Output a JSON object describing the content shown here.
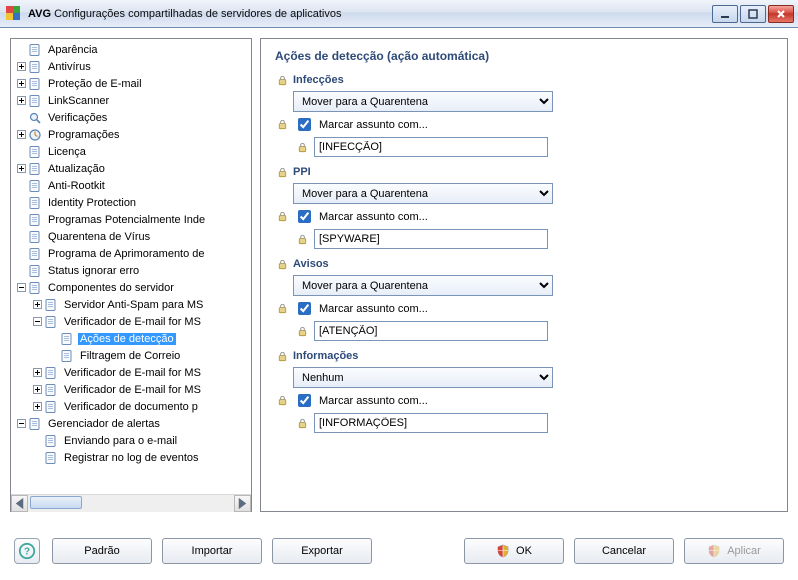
{
  "window": {
    "title_app": "AVG",
    "title_rest": "Configurações compartilhadas de servidores de aplicativos"
  },
  "tree": {
    "items": [
      {
        "level": 1,
        "exp": "",
        "icon": "page",
        "label": "Aparência"
      },
      {
        "level": 1,
        "exp": "plus",
        "icon": "page",
        "label": "Antivírus"
      },
      {
        "level": 1,
        "exp": "plus",
        "icon": "page",
        "label": "Proteção de E-mail"
      },
      {
        "level": 1,
        "exp": "plus",
        "icon": "page",
        "label": "LinkScanner"
      },
      {
        "level": 1,
        "exp": "",
        "icon": "magnify",
        "label": "Verificações"
      },
      {
        "level": 1,
        "exp": "plus",
        "icon": "clock",
        "label": "Programações"
      },
      {
        "level": 1,
        "exp": "",
        "icon": "page",
        "label": "Licença"
      },
      {
        "level": 1,
        "exp": "plus",
        "icon": "page",
        "label": "Atualização"
      },
      {
        "level": 1,
        "exp": "",
        "icon": "page",
        "label": "Anti-Rootkit"
      },
      {
        "level": 1,
        "exp": "",
        "icon": "page",
        "label": "Identity Protection"
      },
      {
        "level": 1,
        "exp": "",
        "icon": "page",
        "label": "Programas Potencialmente Inde"
      },
      {
        "level": 1,
        "exp": "",
        "icon": "page",
        "label": "Quarentena de Vírus"
      },
      {
        "level": 1,
        "exp": "",
        "icon": "page",
        "label": "Programa de Aprimoramento de"
      },
      {
        "level": 1,
        "exp": "",
        "icon": "page",
        "label": "Status ignorar erro"
      },
      {
        "level": 1,
        "exp": "minus",
        "icon": "page",
        "label": "Componentes do servidor"
      },
      {
        "level": 2,
        "exp": "plus",
        "icon": "page",
        "label": "Servidor Anti-Spam para MS"
      },
      {
        "level": 2,
        "exp": "minus",
        "icon": "page",
        "label": "Verificador de E-mail for MS"
      },
      {
        "level": 3,
        "exp": "",
        "icon": "page",
        "label": "Ações de detecção",
        "selected": true
      },
      {
        "level": 3,
        "exp": "",
        "icon": "page",
        "label": "Filtragem de Correio"
      },
      {
        "level": 2,
        "exp": "plus",
        "icon": "page",
        "label": "Verificador de E-mail for MS"
      },
      {
        "level": 2,
        "exp": "plus",
        "icon": "page",
        "label": "Verificador de E-mail for MS"
      },
      {
        "level": 2,
        "exp": "plus",
        "icon": "page",
        "label": "Verificador de documento p"
      },
      {
        "level": 1,
        "exp": "minus",
        "icon": "page",
        "label": "Gerenciador de alertas"
      },
      {
        "level": 2,
        "exp": "",
        "icon": "page",
        "label": "Enviando para o e-mail"
      },
      {
        "level": 2,
        "exp": "",
        "icon": "page",
        "label": "Registrar no log de eventos"
      }
    ]
  },
  "content": {
    "page_title": "Ações de detecção (ação automática)",
    "combo_options": [
      "Mover para a Quarentena",
      "Nenhum"
    ],
    "sections": [
      {
        "title": "Infecções",
        "combo": "Mover para a Quarentena",
        "checked": true,
        "cb_label": "Marcar assunto com...",
        "text": "[INFECÇÃO]"
      },
      {
        "title": "PPI",
        "combo": "Mover para a Quarentena",
        "checked": true,
        "cb_label": "Marcar assunto com...",
        "text": "[SPYWARE]"
      },
      {
        "title": "Avisos",
        "combo": "Mover para a Quarentena",
        "checked": true,
        "cb_label": "Marcar assunto com...",
        "text": "[ATENÇÃO]"
      },
      {
        "title": "Informações",
        "combo": "Nenhum",
        "checked": true,
        "cb_label": "Marcar assunto com...",
        "text": "[INFORMAÇÕES]"
      }
    ]
  },
  "buttons": {
    "padrao": "Padrão",
    "importar": "Importar",
    "exportar": "Exportar",
    "ok": "OK",
    "cancelar": "Cancelar",
    "aplicar": "Aplicar"
  }
}
